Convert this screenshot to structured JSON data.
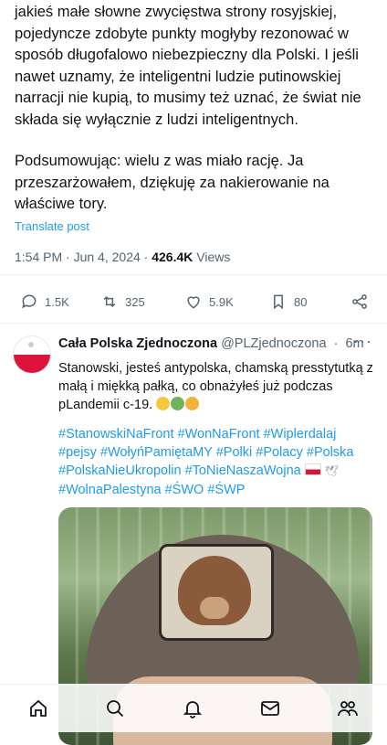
{
  "main_tweet": {
    "paragraph1": "jakieś małe słowne zwycięstwa strony rosyjskiej, pojedyncze zdobyte punkty mogłyby rezonować w sposób długofalowo niebezpieczny dla Polski. I jeśli nawet uznamy, że inteligentni ludzie putinowskiej narracji nie kupią, to musimy też uznać, że świat nie składa się wyłącznie z ludzi inteligentnych.",
    "paragraph2": "Podsumowując: wielu z was miało rację. Ja przeszarżowałem, dziękuję za nakierowanie na właściwe tory.",
    "translate_link": "Translate post",
    "time": "1:54 PM",
    "date": "Jun 4, 2024",
    "views_count": "426.4K",
    "views_label": "Views",
    "actions": {
      "replies": "1.5K",
      "reposts": "325",
      "likes": "5.9K",
      "bookmarks": "80"
    }
  },
  "reply_tweet": {
    "name": "Cała Polska Zjednoczona",
    "handle": "@PLZjednoczona",
    "time": "6m",
    "more": "···",
    "text": "Stanowski, jesteś antypolska, chamską presstytutką z małą i miękką pałką, co obnażyłeś już podczas pLandemii c-19.",
    "hashtags_line1": "#StanowskiNaFront #WonNaFront #Wiplerdalaj",
    "hashtags_line2": "#pejsy #WołyńPamiętaMY #Polki #Polacy #Polska",
    "hashtags_line3": "#PolskaNieUkropolin #ToNieNaszaWojna",
    "hashtags_line4": "#WolnaPalestyna #ŚWO #ŚWP"
  },
  "colors": {
    "link": "#1d9bf0",
    "secondary_text": "#536471",
    "primary_text": "#0f1419"
  }
}
